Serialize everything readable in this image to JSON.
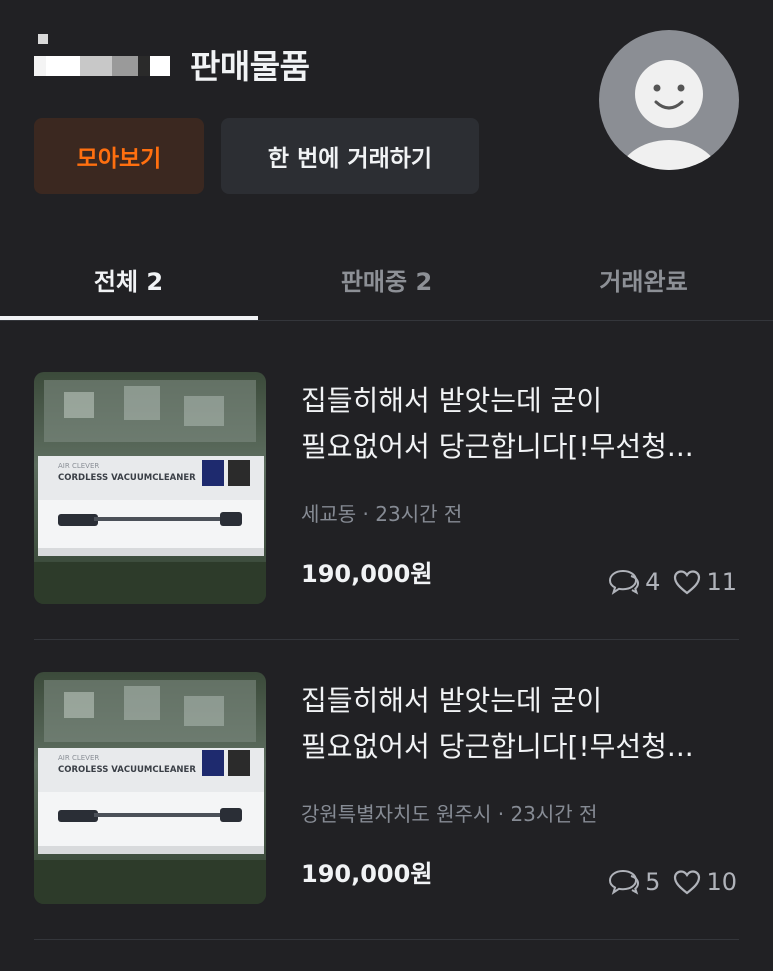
{
  "header": {
    "title": "판매물품",
    "collect_button": "모아보기",
    "bulk_trade_button": "한 번에 거래하기"
  },
  "tabs": [
    {
      "label": "전체 2",
      "active": true
    },
    {
      "label": "판매중 2",
      "active": false
    },
    {
      "label": "거래완료",
      "active": false
    }
  ],
  "items": [
    {
      "title_line1": "집들히해서 받앗는데 굳이",
      "title_line2": "필요없어서 당근합니다[!무선청...",
      "location": "세교동",
      "time": "23시간 전",
      "price": "190,000원",
      "chats": "4",
      "likes": "11",
      "image_text_1": "AIR CLEVER",
      "image_text_2": "CORDLESS VACUUMCLEANER"
    },
    {
      "title_line1": "집들히해서 받앗는데 굳이",
      "title_line2": "필요없어서 당근합니다[!무선청...",
      "location": "강원특별자치도 원주시",
      "time": "23시간 전",
      "price": "190,000원",
      "chats": "5",
      "likes": "10",
      "image_text_1": "AIR CLEVER",
      "image_text_2": "COROLESS VACUUMCLEANER"
    }
  ],
  "meta_separator": " · ",
  "colors": {
    "background": "#212124",
    "accent": "#ff6f0f",
    "text_primary": "#f1f3f5",
    "text_secondary": "#868b94"
  },
  "icons": [
    "chat-bubble-icon",
    "heart-icon",
    "default-profile-icon"
  ]
}
